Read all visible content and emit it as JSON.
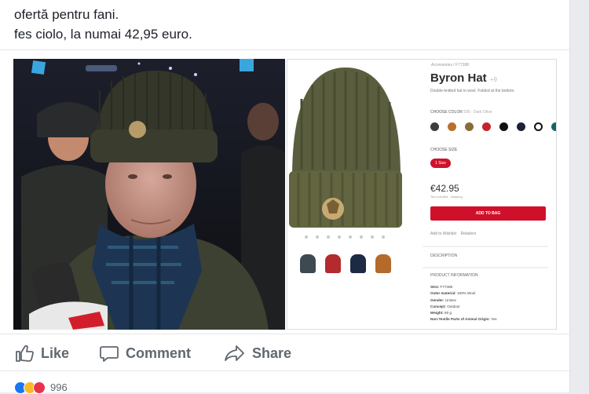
{
  "post": {
    "lines": [
      "ofertă pentru fani.",
      "fes ciolo, la numai 42,95 euro."
    ]
  },
  "product_page": {
    "breadcrumb": "Accessories / F77398",
    "title": "Byron Hat",
    "title_suffix": "+9",
    "description": "Double-knitted hat in wool. Folded at the bottom.",
    "color_label": "CHOOSE COLOR",
    "color_value": "505 · Dark Olive",
    "swatch_colors": [
      "#3b3d3a",
      "#b8702c",
      "#8b6a3c",
      "#c4232e",
      "#111111",
      "#1b2236",
      "#ffffff",
      "#16636a"
    ],
    "size_label": "CHOOSE SIZE",
    "size_value": "1 Size",
    "price": "€42.95",
    "price_note": "Tax included · shipping",
    "add_to_bag": "ADD TO BAG",
    "wishlist": "Add to Wishlist",
    "retailers": "Retailers",
    "description_heading": "DESCRIPTION",
    "info_heading": "PRODUCT INFORMATION",
    "info_rows": [
      {
        "k": "SKU:",
        "v": "F77398"
      },
      {
        "k": "Outer material:",
        "v": "100% Wool"
      },
      {
        "k": "Gender:",
        "v": "Unisex"
      },
      {
        "k": "Concept:",
        "v": "Outdoor"
      },
      {
        "k": "Weight:",
        "v": "80 g"
      },
      {
        "k": "Non-Textile Parts of Animal Origin:",
        "v": "Yes"
      }
    ],
    "thumb_colors": [
      "#3e4a52",
      "#b32a2f",
      "#1d2a44",
      "#b46a2a"
    ]
  },
  "actions": {
    "like": "Like",
    "comment": "Comment",
    "share": "Share"
  },
  "reactions": {
    "count": "996",
    "colors": [
      "#1877f2",
      "#f7b928",
      "#e9334a"
    ]
  }
}
